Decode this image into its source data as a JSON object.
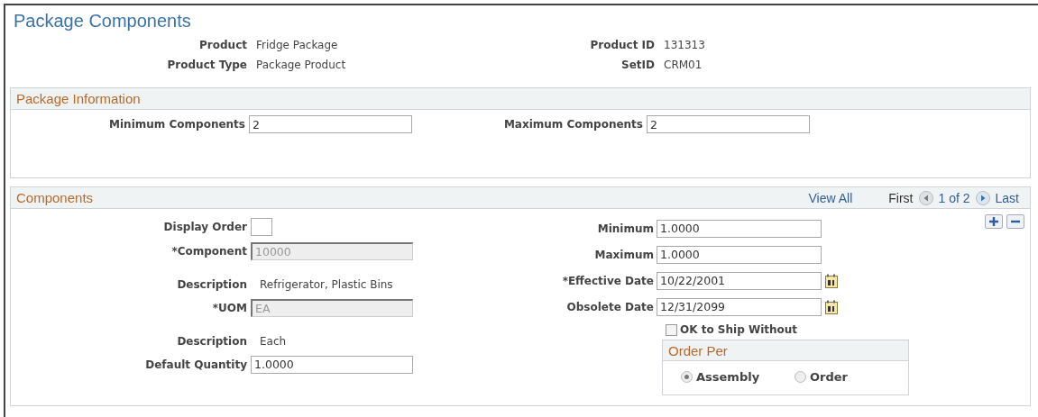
{
  "title": "Package Components",
  "header_fields": [
    {
      "label": "Product",
      "value": "Fridge Package"
    },
    {
      "label": "Product ID",
      "value": "131313"
    },
    {
      "label": "Product Type",
      "value": "Package Product"
    },
    {
      "label": "SetID",
      "value": "CRM01"
    }
  ],
  "package_information": {
    "title": "Package Information",
    "fields": [
      {
        "label": "Minimum Components",
        "value": "2"
      },
      {
        "label": "Maximum Components",
        "value": "2"
      }
    ]
  },
  "components": {
    "title": "Components",
    "nav": {
      "view_all": "View All",
      "first": "First",
      "position": "1 of 2",
      "last": "Last"
    },
    "left_fields": [
      {
        "kind": "small",
        "label": "Display Order"
      },
      {
        "kind": "disabled",
        "label": "*Component",
        "value": "10000"
      },
      {
        "kind": "text",
        "label": "Description",
        "value": "Refrigerator, Plastic Bins"
      },
      {
        "kind": "disabled",
        "label": "*UOM",
        "value": "EA"
      },
      {
        "kind": "text",
        "label": "Description",
        "value": "Each"
      },
      {
        "kind": "input",
        "label": "Default Quantity",
        "value": "1.0000"
      }
    ],
    "right_fields": [
      {
        "kind": "input",
        "label": "Minimum",
        "value": "1.0000"
      },
      {
        "kind": "input",
        "label": "Maximum",
        "value": "1.0000"
      },
      {
        "kind": "date",
        "label": "*Effective Date",
        "value": "10/22/2001"
      },
      {
        "kind": "date",
        "label": "Obsolete Date",
        "value": "12/31/2099"
      }
    ],
    "ok_to_ship": {
      "label": "OK to Ship Without",
      "checked": false
    },
    "order_per": {
      "title": "Order Per",
      "options": [
        {
          "label": "Assembly",
          "selected": true
        },
        {
          "label": "Order",
          "selected": false
        }
      ]
    }
  }
}
